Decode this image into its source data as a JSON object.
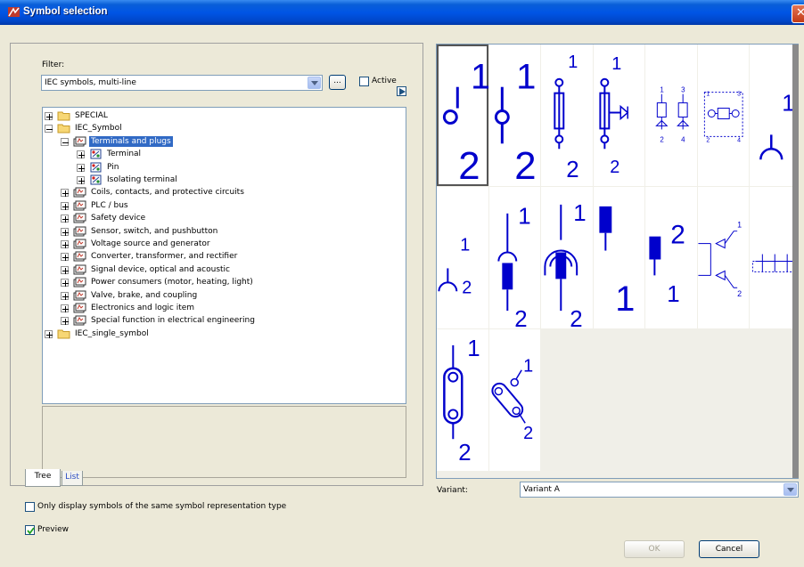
{
  "window": {
    "title": "Symbol selection"
  },
  "filter": {
    "label": "Filter:",
    "value": "IEC symbols, multi-line",
    "browse_label": "...",
    "active_label": "Active",
    "active_checked": false
  },
  "tree": {
    "items": [
      {
        "label": "SPECIAL",
        "level": 0,
        "icon": "folder-icon",
        "expander": "plus"
      },
      {
        "label": "IEC_Symbol",
        "level": 0,
        "icon": "folder-icon",
        "expander": "minus"
      },
      {
        "label": "Terminals and plugs",
        "level": 1,
        "icon": "symbol-group-icon",
        "expander": "minus",
        "selected": true
      },
      {
        "label": "Terminal",
        "level": 2,
        "icon": "symbol-icon",
        "expander": "plus"
      },
      {
        "label": "Pin",
        "level": 2,
        "icon": "symbol-icon",
        "expander": "plus"
      },
      {
        "label": "Isolating terminal",
        "level": 2,
        "icon": "symbol-icon",
        "expander": "plus"
      },
      {
        "label": "Coils, contacts, and protective circuits",
        "level": 1,
        "icon": "symbol-group-icon",
        "expander": "plus"
      },
      {
        "label": "PLC / bus",
        "level": 1,
        "icon": "symbol-group-icon",
        "expander": "plus"
      },
      {
        "label": "Safety device",
        "level": 1,
        "icon": "symbol-group-icon",
        "expander": "plus"
      },
      {
        "label": "Sensor, switch, and pushbutton",
        "level": 1,
        "icon": "symbol-group-icon",
        "expander": "plus"
      },
      {
        "label": "Voltage source and generator",
        "level": 1,
        "icon": "symbol-group-icon",
        "expander": "plus"
      },
      {
        "label": "Converter, transformer, and rectifier",
        "level": 1,
        "icon": "symbol-group-icon",
        "expander": "plus"
      },
      {
        "label": "Signal device, optical and acoustic",
        "level": 1,
        "icon": "symbol-group-icon",
        "expander": "plus"
      },
      {
        "label": "Power consumers (motor, heating, light)",
        "level": 1,
        "icon": "symbol-group-icon",
        "expander": "plus"
      },
      {
        "label": "Valve, brake, and coupling",
        "level": 1,
        "icon": "symbol-group-icon",
        "expander": "plus"
      },
      {
        "label": "Electronics and logic item",
        "level": 1,
        "icon": "symbol-group-icon",
        "expander": "plus"
      },
      {
        "label": "Special function in electrical engineering",
        "level": 1,
        "icon": "symbol-group-icon",
        "expander": "plus"
      },
      {
        "label": "IEC_single_symbol",
        "level": 0,
        "icon": "folder-icon",
        "expander": "plus"
      }
    ]
  },
  "tabs": [
    {
      "label": "Tree",
      "active": true
    },
    {
      "label": "List",
      "active": false
    }
  ],
  "options": {
    "same_type_label": "Only display symbols of the same symbol representation type",
    "same_type_checked": false,
    "preview_label": "Preview",
    "preview_checked": true
  },
  "symbols": {
    "selected_index": 0,
    "items": [
      {
        "icon": "terminal-symbol-icon",
        "labels": [
          "1",
          "2"
        ]
      },
      {
        "icon": "terminal-symbol-icon",
        "labels": [
          "1",
          "2"
        ]
      },
      {
        "icon": "isolating-terminal-icon",
        "labels": [
          "1",
          "2"
        ]
      },
      {
        "icon": "terminal-led-icon",
        "labels": [
          "1",
          "2"
        ]
      },
      {
        "icon": "dual-terminal-icon",
        "labels": [
          "1",
          "2",
          "3",
          "4"
        ]
      },
      {
        "icon": "connector-block-icon",
        "labels": [
          "1",
          "2",
          "3",
          "4"
        ]
      },
      {
        "icon": "socket-icon",
        "labels": [
          "1"
        ]
      },
      {
        "icon": "socket-icon",
        "labels": [
          "1",
          "2"
        ]
      },
      {
        "icon": "plug-socket-icon",
        "labels": [
          "1",
          "2"
        ]
      },
      {
        "icon": "shielded-plug-icon",
        "labels": [
          "1",
          "2"
        ]
      },
      {
        "icon": "pin-icon",
        "labels": [
          "1"
        ]
      },
      {
        "icon": "pin-icon",
        "labels": [
          "2",
          "1"
        ]
      },
      {
        "icon": "plug-pair-icon",
        "labels": [
          "1",
          "2"
        ]
      },
      {
        "icon": "multi-terminal-icon",
        "labels": []
      },
      {
        "icon": "link-terminal-icon",
        "labels": [
          "1",
          "2"
        ]
      },
      {
        "icon": "link-terminal-diagonal-icon",
        "labels": [
          "1",
          "2"
        ]
      }
    ]
  },
  "variant": {
    "label": "Variant:",
    "value": "Variant A"
  },
  "buttons": {
    "ok": "OK",
    "cancel": "Cancel"
  },
  "colors": {
    "symbol_blue": "#0000cc",
    "selection": "#316ac5",
    "title_bar": "#0055e5"
  }
}
